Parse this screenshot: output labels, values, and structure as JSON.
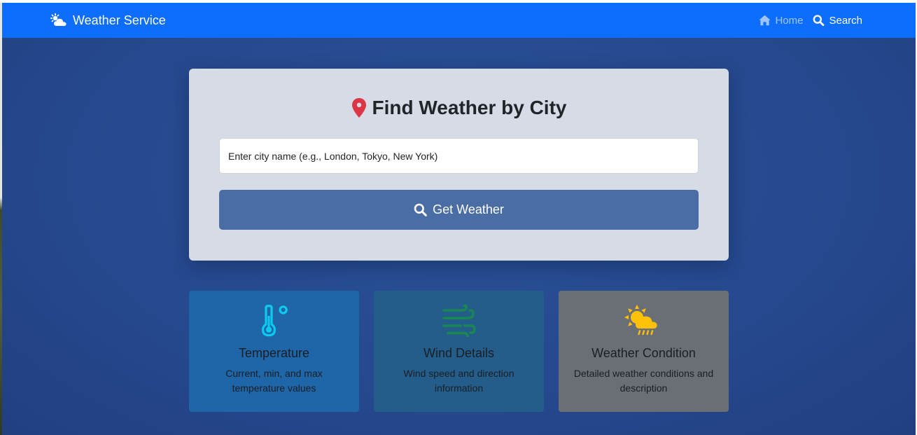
{
  "navbar": {
    "brand": "Weather Service",
    "brand_icon": "cloud-sun-icon",
    "links": [
      {
        "label": "Home",
        "icon": "home-icon"
      },
      {
        "label": "Search",
        "icon": "search-icon"
      }
    ],
    "color": "#0d6efd"
  },
  "search": {
    "title": "Find Weather by City",
    "title_icon": "map-pin-icon",
    "placeholder": "Enter city name (e.g., London, Tokyo, New York)",
    "value": "",
    "button_label": "Get Weather",
    "button_icon": "search-icon"
  },
  "features": [
    {
      "title": "Temperature",
      "description": "Current, min, and max temperature values",
      "icon": "thermometer-icon",
      "icon_color": "#0dcaf0"
    },
    {
      "title": "Wind Details",
      "description": "Wind speed and direction information",
      "icon": "wind-icon",
      "icon_color": "#198754"
    },
    {
      "title": "Weather Condition",
      "description": "Detailed weather conditions and description",
      "icon": "sun-cloud-rain-icon",
      "icon_color": "#ffc107"
    }
  ],
  "colors": {
    "background": "#26498f",
    "accent": "#0d6efd",
    "pin": "#dc3545"
  }
}
